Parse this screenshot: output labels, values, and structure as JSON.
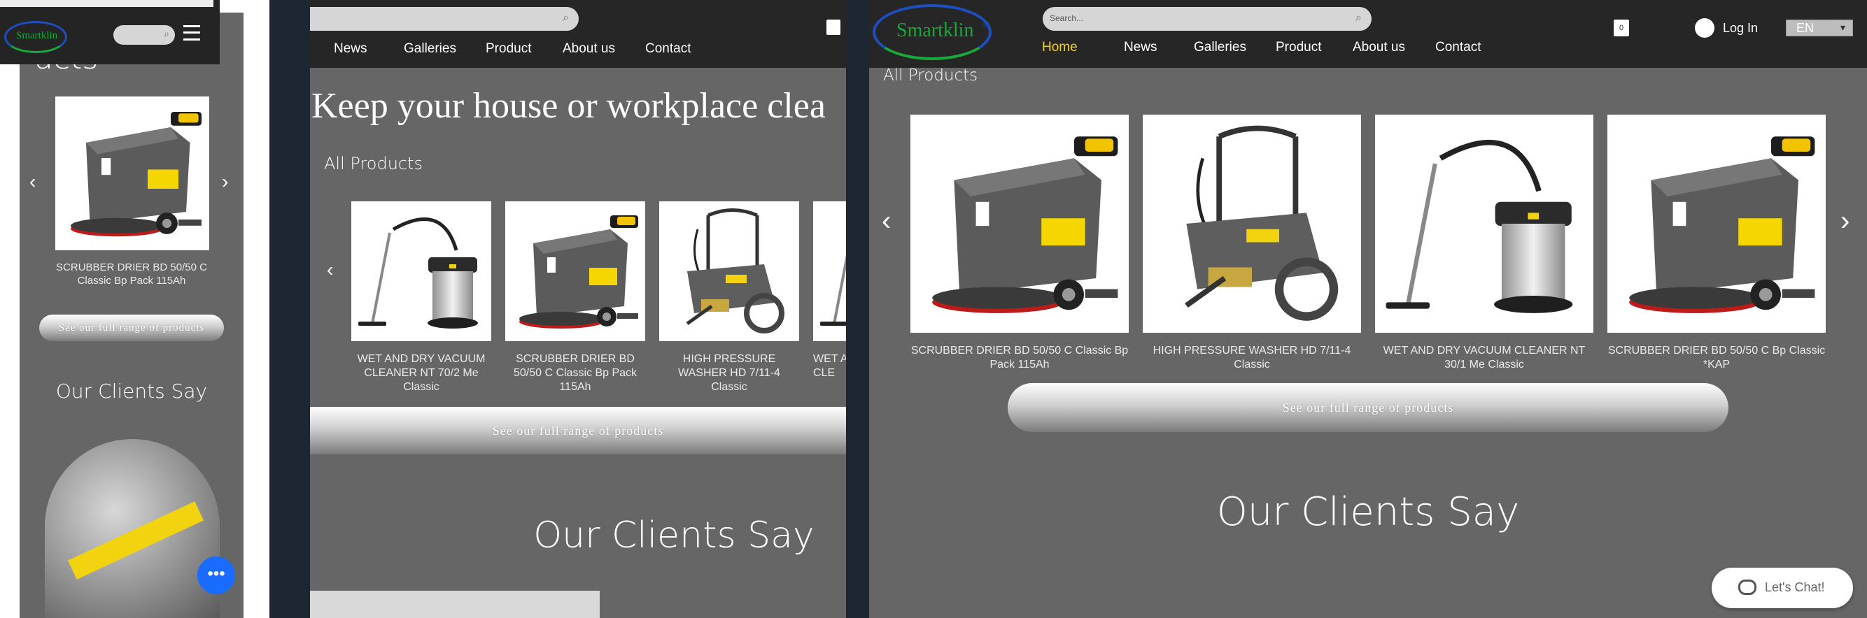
{
  "brand": {
    "logo_text": "Smartklin",
    "logo_mark": "®"
  },
  "nav": {
    "home": "Home",
    "news": "News",
    "galleries": "Galleries",
    "product": "Product",
    "about": "About us",
    "contact": "Contact"
  },
  "search": {
    "placeholder": "Search..."
  },
  "account": {
    "login": "Log In",
    "language": "EN",
    "cart_count": "0"
  },
  "hero": {
    "headline": "Keep your house or workplace clea"
  },
  "section": {
    "all_products": "All Products",
    "cta": "See our full range of products",
    "clients_title": "Our Clients Say"
  },
  "mobile": {
    "heading_fragment": "ucts",
    "product_name": "SCRUBBER DRIER BD 50/50 C Classic Bp Pack 115Ah"
  },
  "tablet": {
    "products": [
      {
        "name": "WET AND DRY VACUUM CLEANER NT 70/2 Me Classic",
        "icon": "vacuum-cleaner-image"
      },
      {
        "name": "SCRUBBER DRIER BD 50/50 C Classic Bp Pack 115Ah",
        "icon": "scrubber-drier-image"
      },
      {
        "name": "HIGH PRESSURE WASHER HD 7/11-4 Classic",
        "icon": "pressure-washer-image"
      },
      {
        "name": "WET AND DRY VACUUM CLE",
        "icon": "vacuum-cleaner-image"
      }
    ]
  },
  "desktop": {
    "products": [
      {
        "name": "SCRUBBER DRIER BD 50/50 C Classic Bp Pack 115Ah",
        "icon": "scrubber-drier-image"
      },
      {
        "name": "HIGH PRESSURE WASHER HD 7/11-4 Classic",
        "icon": "pressure-washer-image"
      },
      {
        "name": "WET AND DRY VACUUM CLEANER NT 30/1 Me Classic",
        "icon": "vacuum-cleaner-image"
      },
      {
        "name": "SCRUBBER DRIER BD 50/50 C Bp Classic *KAP",
        "icon": "scrubber-drier-image"
      }
    ]
  },
  "chat": {
    "label": "Let's Chat!"
  },
  "colors": {
    "nav_active": "#f2d30f",
    "page_bg": "#666666",
    "header_bg": "#262626",
    "chat_button": "#1a6bff"
  }
}
